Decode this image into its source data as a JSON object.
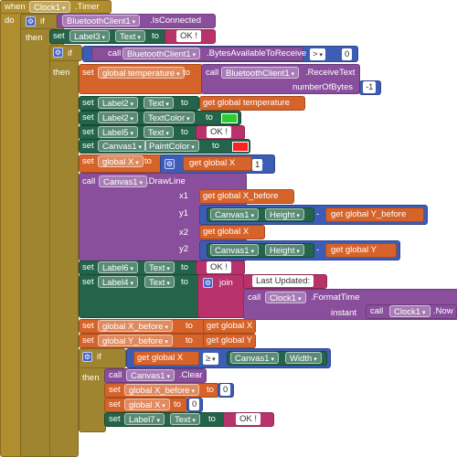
{
  "colors": {
    "event": "#b08d2e",
    "control": "#9f8530",
    "component_set": "#23644a",
    "component_call": "#8a4f9c",
    "variable": "#d6632a",
    "math": "#3d5cb4",
    "text": "#b8326b",
    "green_swatch": "#2ecc2e",
    "red_swatch": "#ff2020"
  },
  "kw": {
    "when": "when",
    "do": "do",
    "if": "if",
    "then": "then",
    "set": "set",
    "call": "call",
    "to": "to",
    "join": "join",
    "instant": "instant"
  },
  "event": {
    "component": "Clock1",
    "name": ".Timer"
  },
  "if1": {
    "component": "BluetoothClient1",
    "prop": ".IsConnected"
  },
  "s_label3": {
    "component": "Label3",
    "prop": "Text",
    "value": "OK !"
  },
  "if2": {
    "component": "BluetoothClient1",
    "method": ".BytesAvailableToReceive",
    "op": ">",
    "value": "0"
  },
  "temp": {
    "var": "global temperature",
    "component": "BluetoothClient1",
    "method": ".ReceiveText",
    "param": "numberOfBytes",
    "param_value": "-1"
  },
  "s_label2_text": {
    "component": "Label2",
    "prop": "Text",
    "value": "get global temperature"
  },
  "s_label2_color": {
    "component": "Label2",
    "prop": "TextColor"
  },
  "s_label5": {
    "component": "Label5",
    "prop": "Text",
    "value": "OK !"
  },
  "s_canvas_paint": {
    "component": "Canvas1",
    "prop": "PaintColor"
  },
  "s_globalx": {
    "var": "global X",
    "get": "get global X",
    "op": "+",
    "value": "1"
  },
  "drawline": {
    "component": "Canvas1",
    "method": ".DrawLine",
    "x1": "x1",
    "x1_get": "get global X_before",
    "y1": "y1",
    "y1_comp": "Canvas1",
    "y1_prop": "Height",
    "y1_op": "-",
    "y1_get": "get global Y_before",
    "x2": "x2",
    "x2_get": "get global X",
    "y2": "y2",
    "y2_comp": "Canvas1",
    "y2_prop": "Height",
    "y2_op": "-",
    "y2_get": "get global Y"
  },
  "s_label6": {
    "component": "Label6",
    "prop": "Text",
    "value": "OK !"
  },
  "s_label4": {
    "component": "Label4",
    "prop": "Text",
    "prefix": "Last Updated:",
    "clock": "Clock1",
    "fmt": ".FormatTime",
    "clock2": "Clock1",
    "now": ".Now"
  },
  "s_xbefore": {
    "var": "global X_before",
    "get": "get global X"
  },
  "s_ybefore": {
    "var": "global Y_before",
    "get": "get global Y"
  },
  "if3": {
    "get": "get global X",
    "op": "≥",
    "comp": "Canvas1",
    "prop": "Width"
  },
  "clear": {
    "component": "Canvas1",
    "method": ".Clear"
  },
  "s_xbefore0": {
    "var": "global X_before",
    "value": "0"
  },
  "s_x0": {
    "var": "global X",
    "value": "0"
  },
  "s_label7": {
    "component": "Label7",
    "prop": "Text",
    "value": "OK !"
  }
}
